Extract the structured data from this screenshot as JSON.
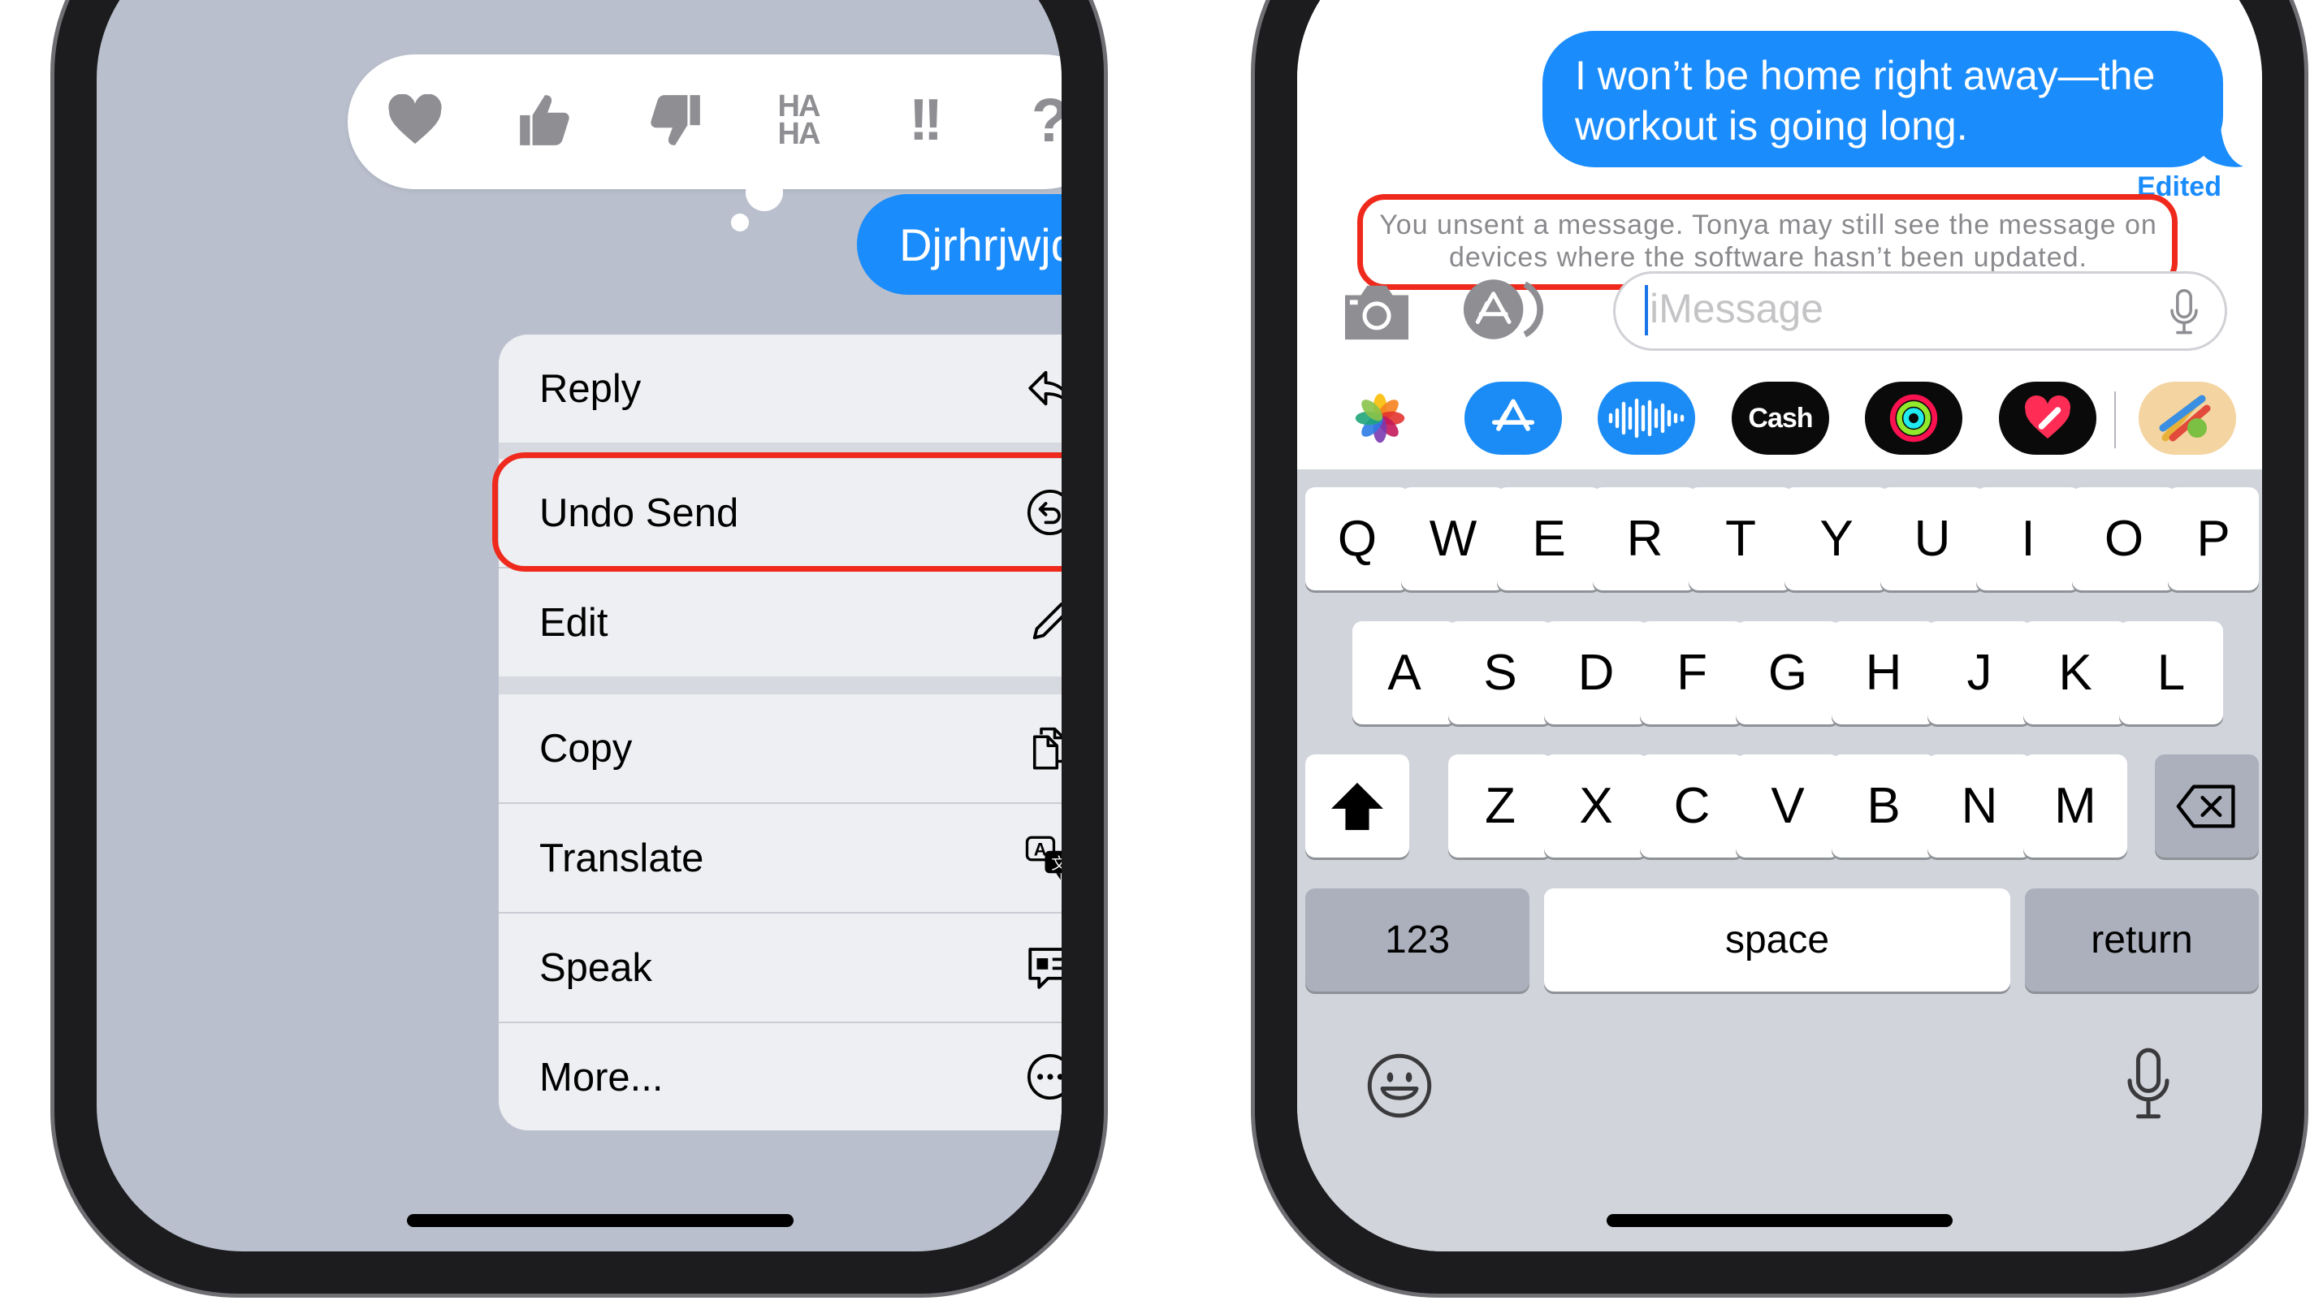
{
  "left_phone": {
    "tapbacks": [
      {
        "icon": "heart-icon"
      },
      {
        "icon": "thumbs-up-icon"
      },
      {
        "icon": "thumbs-down-icon"
      },
      {
        "icon": "haha-icon",
        "text": "HA\nHA"
      },
      {
        "icon": "exclamation-icon",
        "text": "!!"
      },
      {
        "icon": "question-icon",
        "text": "?"
      }
    ],
    "message": "Djrhrjwjd",
    "menu": {
      "items": [
        {
          "label": "Reply",
          "icon": "reply-arrow-icon"
        },
        {
          "label": "Undo Send",
          "icon": "undo-send-icon"
        },
        {
          "label": "Edit",
          "icon": "pencil-icon"
        },
        {
          "label": "Copy",
          "icon": "copy-icon"
        },
        {
          "label": "Translate",
          "icon": "translate-icon"
        },
        {
          "label": "Speak",
          "icon": "speak-icon"
        },
        {
          "label": "More...",
          "icon": "more-icon"
        }
      ]
    }
  },
  "right_phone": {
    "message": "I won’t be home right away—the workout is going long.",
    "edited_label": "Edited",
    "notice": "You unsent a message. Tonya may still see the message on devices where the software hasn’t been updated.",
    "input_placeholder": "iMessage",
    "apps": [
      {
        "icon": "photos-icon"
      },
      {
        "icon": "app-store-icon"
      },
      {
        "icon": "audio-message-icon"
      },
      {
        "icon": "apple-cash-icon",
        "label": "Cash"
      },
      {
        "icon": "activity-icon"
      },
      {
        "icon": "digital-touch-icon"
      },
      {
        "icon": "memoji-paint-icon"
      }
    ],
    "keyboard": {
      "row1": [
        "Q",
        "W",
        "E",
        "R",
        "T",
        "Y",
        "U",
        "I",
        "O",
        "P"
      ],
      "row2": [
        "A",
        "S",
        "D",
        "F",
        "G",
        "H",
        "J",
        "K",
        "L"
      ],
      "row3": [
        "Z",
        "X",
        "C",
        "V",
        "B",
        "N",
        "M"
      ],
      "numbers_key": "123",
      "space_key": "space",
      "return_key": "return"
    }
  },
  "colors": {
    "imessage_blue": "#1a8cfb",
    "highlight_red": "#ef2a1c",
    "keyboard_bg": "#d1d4db",
    "dim_bg": "#b9bfcd"
  }
}
